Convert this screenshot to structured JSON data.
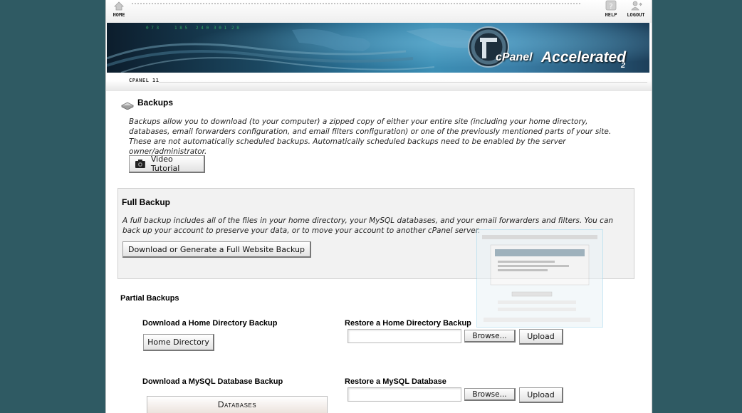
{
  "topnav": {
    "home_label": "Home",
    "help_label": "Help",
    "logout_label": "Logout"
  },
  "banner": {
    "brand": "cPanel",
    "product": "Accelerated",
    "version_mark": "2"
  },
  "breadcrumb": {
    "label": "CPANEL 11"
  },
  "page": {
    "title": "Backups",
    "intro": "Backups allow you to download (to your computer) a zipped copy of either your entire site (including your home directory, databases, email forwarders configuration, and email filters configuration) or one of the previously mentioned parts of your site. These are not automatically scheduled backups. Automatically scheduled backups need to be enabled by the server owner/administrator.",
    "video_button": "Video Tutorial"
  },
  "full_backup": {
    "title": "Full Backup",
    "description": "A full backup includes all of the files in your home directory, your MySQL databases, and your email forwarders and filters. You can back up your account to preserve your data, or to move your account to another cPanel server.",
    "button": "Download or Generate a Full Website Backup"
  },
  "partial_backups": {
    "title": "Partial Backups",
    "home": {
      "download_heading": "Download a Home Directory Backup",
      "download_button": "Home Directory",
      "restore_heading": "Restore a Home Directory Backup",
      "browse_button": "Browse...",
      "upload_button": "Upload"
    },
    "mysql": {
      "download_heading": "Download a MySQL Database Backup",
      "restore_heading": "Restore a MySQL Database",
      "browse_button": "Browse...",
      "upload_button": "Upload",
      "table_header": "Databases"
    }
  },
  "colors": {
    "background": "#2f5a63",
    "panel": "#f2f2f2",
    "banner_accent": "#3d8fb5"
  }
}
